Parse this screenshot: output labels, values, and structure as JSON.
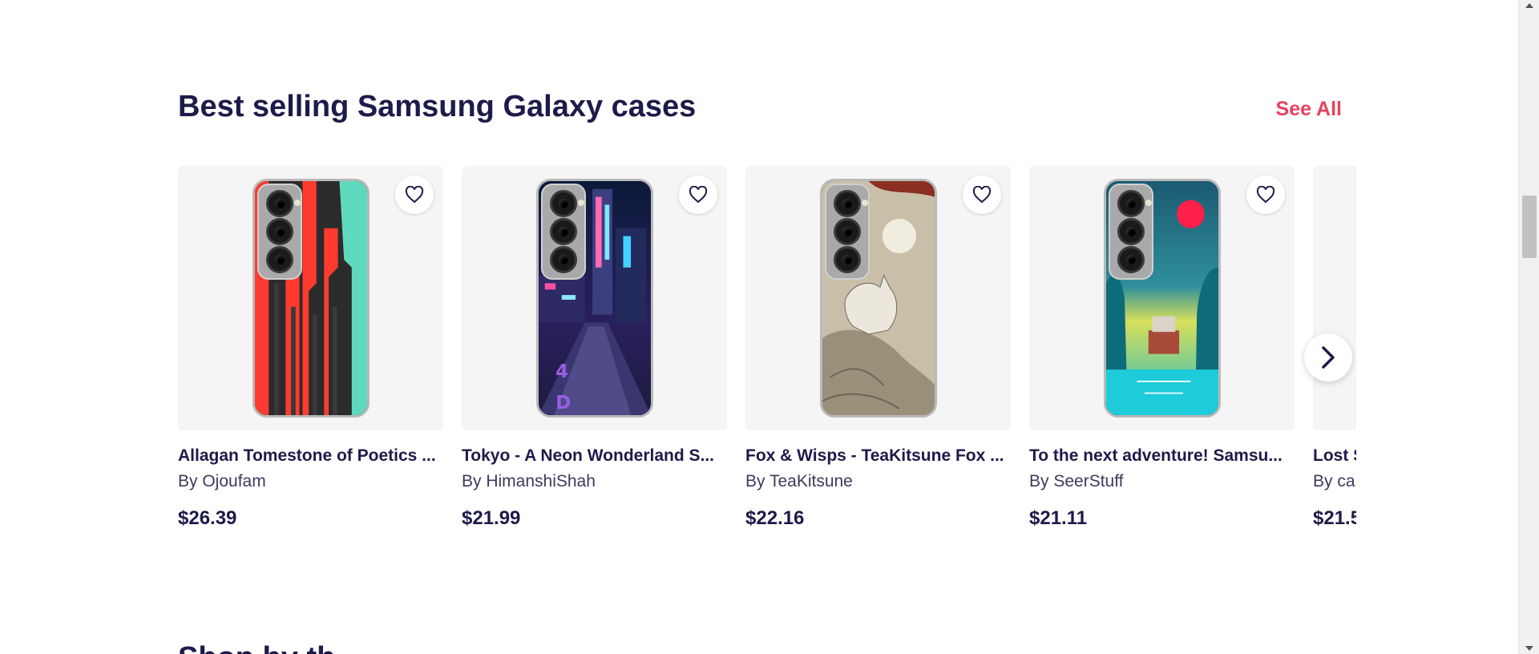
{
  "section": {
    "title": "Best selling Samsung Galaxy cases",
    "see_all_label": "See All"
  },
  "products": [
    {
      "title": "Allagan Tomestone of Poetics ...",
      "artist": "By Ojoufam",
      "price": "$26.39",
      "art": "stripes",
      "icon": "heart-outline-icon"
    },
    {
      "title": "Tokyo - A Neon Wonderland S...",
      "artist": "By HimanshiShah",
      "price": "$21.99",
      "art": "neon-street",
      "icon": "heart-outline-icon"
    },
    {
      "title": "Fox & Wisps - TeaKitsune Fox ...",
      "artist": "By TeaKitsune",
      "price": "$22.16",
      "art": "fox",
      "icon": "heart-outline-icon"
    },
    {
      "title": "To the next adventure! Samsu...",
      "artist": "By SeerStuff",
      "price": "$21.11",
      "art": "lagoon",
      "icon": "heart-outline-icon"
    },
    {
      "title": "Lost S",
      "artist": "By ca",
      "price": "$21.5",
      "art": "partial",
      "icon": "heart-outline-icon"
    }
  ],
  "carousel": {
    "next_icon": "chevron-right-icon"
  },
  "next_section": {
    "title": "Shop by th"
  },
  "colors": {
    "heading": "#1d1b4a",
    "accent": "#e6425e",
    "card_bg": "#f5f5f5"
  }
}
